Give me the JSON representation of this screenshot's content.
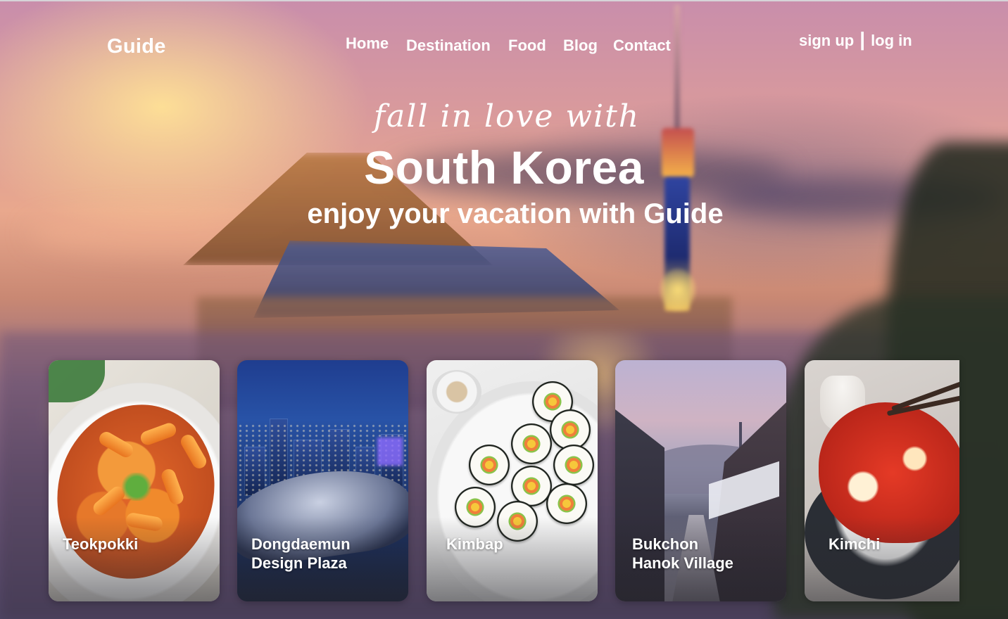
{
  "header": {
    "logo": "Guide",
    "nav": [
      {
        "label": "Home"
      },
      {
        "label": "Destination"
      },
      {
        "label": "Food"
      },
      {
        "label": "Blog"
      },
      {
        "label": "Contact"
      }
    ],
    "auth": {
      "sign_up": "sign up",
      "separator": "|",
      "log_in": "log in"
    }
  },
  "hero": {
    "script": "fall in love with",
    "title": "South Korea",
    "subtitle": "enjoy your vacation with Guide"
  },
  "cards": [
    {
      "lines": [
        "Teokpokki"
      ],
      "image": "teokpokki-photo"
    },
    {
      "lines": [
        "Dongdaemun",
        "Design Plaza"
      ],
      "image": "ddp-photo"
    },
    {
      "lines": [
        "Kimbap"
      ],
      "image": "kimbap-photo"
    },
    {
      "lines": [
        "Bukchon",
        "Hanok Village"
      ],
      "image": "bukchon-photo"
    },
    {
      "lines": [
        "Kimchi"
      ],
      "image": "kimchi-photo"
    }
  ],
  "colors": {
    "text": "#ffffff",
    "sky_warm": "#e9a88d",
    "sky_purple": "#c98eab"
  }
}
